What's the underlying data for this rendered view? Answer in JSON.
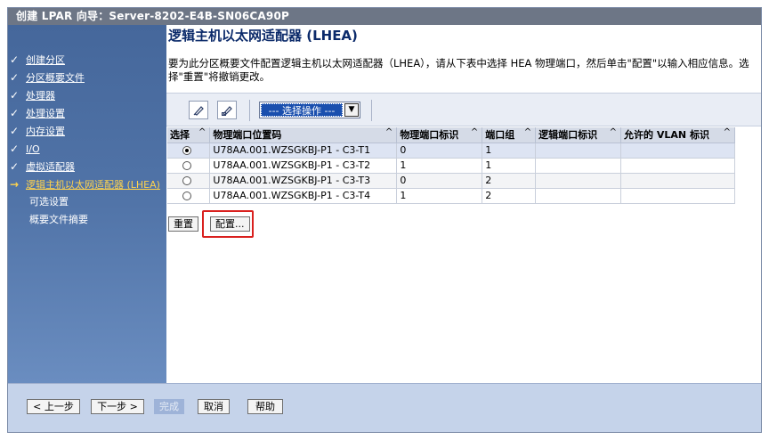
{
  "window": {
    "title": "创建 LPAR 向导：Server-8202-E4B-SN06CA90P"
  },
  "sidebar": {
    "items": [
      {
        "label": "创建分区",
        "mark": "✓",
        "state": "done"
      },
      {
        "label": "分区概要文件",
        "mark": "✓",
        "state": "done"
      },
      {
        "label": "处理器",
        "mark": "✓",
        "state": "done"
      },
      {
        "label": "处理设置",
        "mark": "✓",
        "state": "done"
      },
      {
        "label": "内存设置",
        "mark": "✓",
        "state": "done"
      },
      {
        "label": "I/O",
        "mark": "✓",
        "state": "done"
      },
      {
        "label": "虚拟适配器",
        "mark": "✓",
        "state": "done"
      },
      {
        "label": "逻辑主机以太网适配器 (LHEA)",
        "mark": "→",
        "state": "current"
      },
      {
        "label": "可选设置",
        "mark": "",
        "state": "pending"
      },
      {
        "label": "概要文件摘要",
        "mark": "",
        "state": "pending"
      }
    ]
  },
  "main": {
    "title": "逻辑主机以太网适配器 (LHEA)",
    "instructions": "要为此分区概要文件配置逻辑主机以太网适配器（LHEA），请从下表中选择 HEA 物理端口，然后单击\"配置\"以输入相应信息。选择\"重置\"将撤销更改。",
    "toolbar": {
      "select_all_icon": "select-all-icon",
      "deselect_all_icon": "deselect-all-icon",
      "action_select_value": "--- 选择操作 ---"
    },
    "table": {
      "sort_glyph": "^",
      "columns": [
        "选择",
        "物理端口位置码",
        "物理端口标识",
        "端口组",
        "逻辑端口标识",
        "允许的 VLAN 标识"
      ],
      "rows": [
        {
          "selected": true,
          "location": "U78AA.001.WZSGKBJ-P1 - C3-T1",
          "port_id": "0",
          "port_group": "1",
          "logical_port_id": "",
          "vlan_ids": ""
        },
        {
          "selected": false,
          "location": "U78AA.001.WZSGKBJ-P1 - C3-T2",
          "port_id": "1",
          "port_group": "1",
          "logical_port_id": "",
          "vlan_ids": ""
        },
        {
          "selected": false,
          "location": "U78AA.001.WZSGKBJ-P1 - C3-T3",
          "port_id": "0",
          "port_group": "2",
          "logical_port_id": "",
          "vlan_ids": ""
        },
        {
          "selected": false,
          "location": "U78AA.001.WZSGKBJ-P1 - C3-T4",
          "port_id": "1",
          "port_group": "2",
          "logical_port_id": "",
          "vlan_ids": ""
        }
      ]
    },
    "buttons": {
      "reset": "重置",
      "configure": "配置..."
    }
  },
  "footer": {
    "back": "< 上一步",
    "next": "下一步 >",
    "finish": "完成",
    "cancel": "取消",
    "help": "帮助"
  },
  "colors": {
    "title_bar": "#6d7686",
    "sidebar": "#5174a8",
    "current_step": "#ffd34d",
    "highlight": "#d9201e",
    "bottom_bar": "#c5d3ea"
  }
}
